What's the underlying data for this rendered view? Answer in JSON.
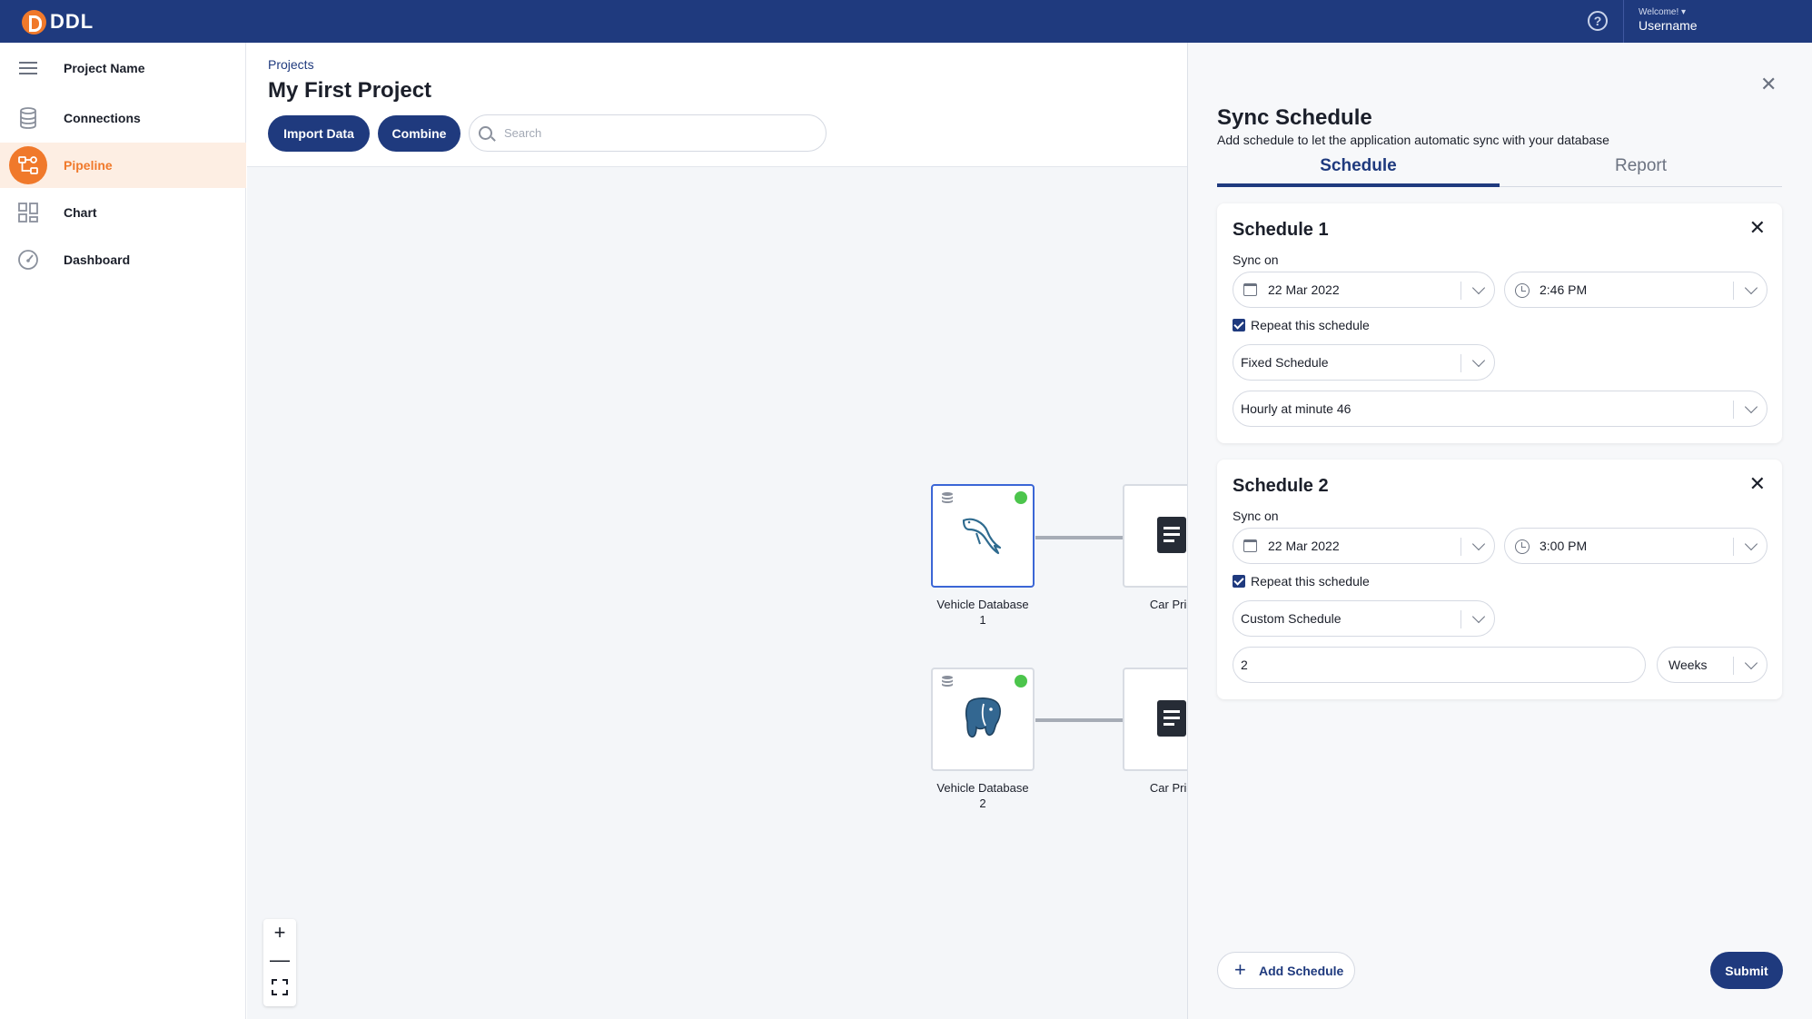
{
  "app": {
    "logo_text": "DDL",
    "welcome": "Welcome! ▾",
    "username": "Username"
  },
  "colors": {
    "primary": "#1f3a7e",
    "accent": "#f0792b",
    "status_ok": "#4cc54c"
  },
  "sidebar": {
    "project_name": "Project Name",
    "items": [
      {
        "label": "Connections",
        "icon": "database-icon"
      },
      {
        "label": "Pipeline",
        "icon": "pipeline-icon",
        "active": true
      },
      {
        "label": "Chart",
        "icon": "grid-icon"
      },
      {
        "label": "Dashboard",
        "icon": "gauge-icon"
      }
    ]
  },
  "header": {
    "breadcrumb": "Projects",
    "title": "My First Project",
    "import_label": "Import Data",
    "combine_label": "Combine",
    "search_placeholder": "Search"
  },
  "pipeline": {
    "nodes": [
      {
        "label_line1": "Vehicle Database",
        "label_line2": "1",
        "icon": "mysql-dolphin-icon",
        "status": "connected"
      },
      {
        "label_line1": "Vehicle Database",
        "label_line2": "2",
        "icon": "postgres-elephant-icon",
        "status": "connected"
      },
      {
        "label": "Car Price",
        "icon": "document-icon"
      },
      {
        "label": "Car Price",
        "icon": "document-icon"
      }
    ],
    "zoom_in": "+",
    "zoom_out": "—"
  },
  "panel": {
    "title": "Sync Schedule",
    "subtitle": "Add schedule to let the application automatic sync with your database",
    "tabs": [
      {
        "label": "Schedule",
        "active": true
      },
      {
        "label": "Report",
        "active": false
      }
    ],
    "schedules": [
      {
        "title": "Schedule 1",
        "sync_label": "Sync on",
        "date": "22 Mar 2022",
        "time": "2:46 PM",
        "repeat_label": "Repeat this schedule",
        "repeat_checked": true,
        "mode": "Fixed Schedule",
        "frequency": "Hourly at minute 46"
      },
      {
        "title": "Schedule 2",
        "sync_label": "Sync on",
        "date": "22 Mar 2022",
        "time": "3:00 PM",
        "repeat_label": "Repeat this schedule",
        "repeat_checked": true,
        "mode": "Custom Schedule",
        "interval_value": "2",
        "interval_unit": "Weeks"
      }
    ],
    "add_label": "Add Schedule",
    "submit_label": "Submit"
  }
}
